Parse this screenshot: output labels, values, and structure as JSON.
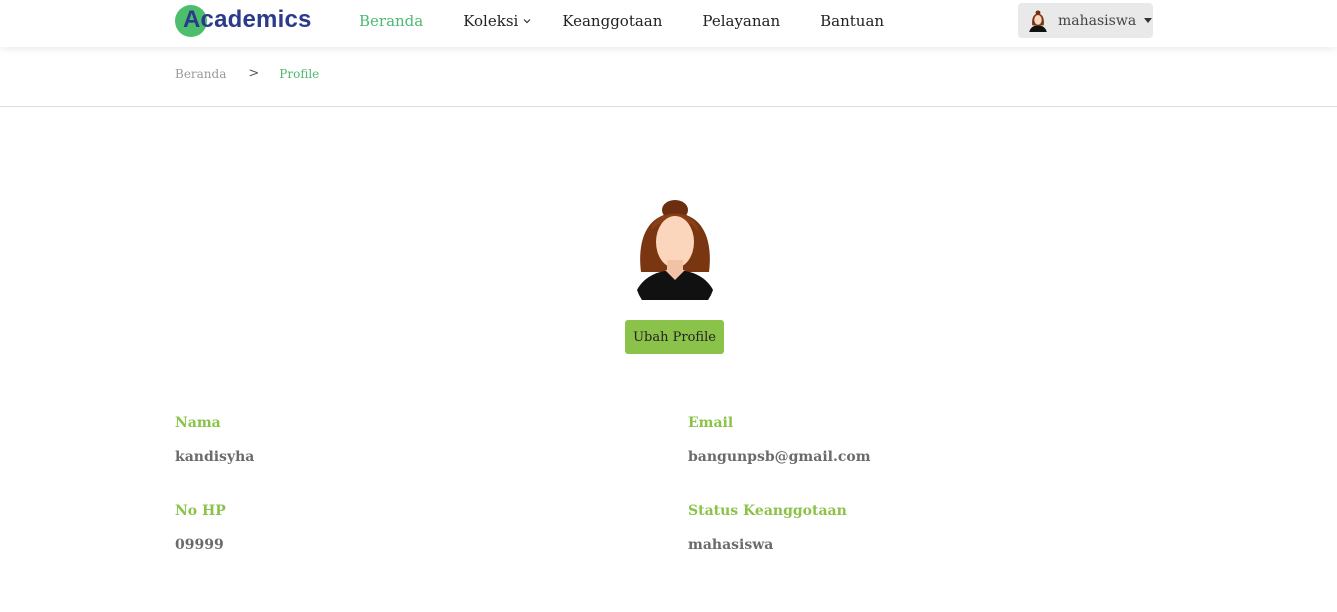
{
  "brand": {
    "name": "Academics",
    "accent": "#4cbe6c",
    "text_color": "#2b3a8a"
  },
  "nav": {
    "items": [
      {
        "label": "Beranda",
        "active": true
      },
      {
        "label": "Koleksi",
        "has_dropdown": true
      },
      {
        "label": "Keanggotaan"
      },
      {
        "label": "Pelayanan"
      },
      {
        "label": "Bantuan"
      }
    ],
    "user": {
      "name": "mahasiswa",
      "icon": "woman-avatar-icon"
    }
  },
  "breadcrumb": {
    "home": "Beranda",
    "separator": ">",
    "current": "Profile"
  },
  "profile": {
    "avatar_icon": "woman-avatar-icon",
    "edit_label": "Ubah Profile",
    "fields": {
      "nama": {
        "label": "Nama",
        "value": "kandisyha"
      },
      "email": {
        "label": "Email",
        "value": "bangunpsb@gmail.com"
      },
      "hp": {
        "label": "No HP",
        "value": "09999"
      },
      "status": {
        "label": "Status Keanggotaan",
        "value": "mahasiswa"
      }
    }
  },
  "colors": {
    "active_nav": "#4cb870",
    "label_green": "#8bc34a",
    "button_green": "#8bc34a"
  }
}
